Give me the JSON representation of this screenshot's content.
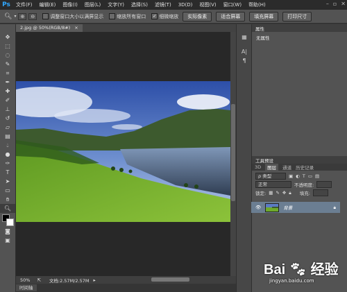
{
  "app": {
    "logo": "Ps"
  },
  "menu": [
    "文件(F)",
    "编辑(E)",
    "图像(I)",
    "图层(L)",
    "文字(Y)",
    "选择(S)",
    "滤镜(T)",
    "3D(D)",
    "视图(V)",
    "窗口(W)",
    "帮助(H)"
  ],
  "options": {
    "zoom_icon": "zoom-icon",
    "checkboxes": [
      {
        "label": "调整窗口大小以满屏显示",
        "checked": false
      },
      {
        "label": "缩放所有窗口",
        "checked": false
      },
      {
        "label": "细微缩放",
        "checked": true
      }
    ],
    "buttons": [
      "实际像素",
      "适合屏幕",
      "填充屏幕",
      "打印尺寸"
    ]
  },
  "document": {
    "tab_title": "2.jpg @ 50%(RGB/8#)",
    "zoom_level": "50%",
    "doc_info": "文档:2.57M/2.57M",
    "timeline_label": "时间轴"
  },
  "properties": {
    "title": "属性",
    "empty_text": "无属性"
  },
  "layers_panel": {
    "tool_preset_tab": "工具预设",
    "tabs": [
      "3D",
      "图层",
      "通道",
      "历史记录"
    ],
    "active_tab": "图层",
    "filter_label": "ρ 类型",
    "blend_mode": "正常",
    "opacity_label": "不透明度:",
    "lock_label": "锁定:",
    "fill_label": "填充:",
    "layer_name": "背景"
  },
  "watermark": {
    "text": "Bai",
    "text2": "经验",
    "url": "jingyan.baidu.com"
  },
  "colors": {
    "accent": "#31a8ff",
    "panel": "#535353",
    "canvas_bg": "#282828",
    "selected_layer": "#6b7e92"
  }
}
